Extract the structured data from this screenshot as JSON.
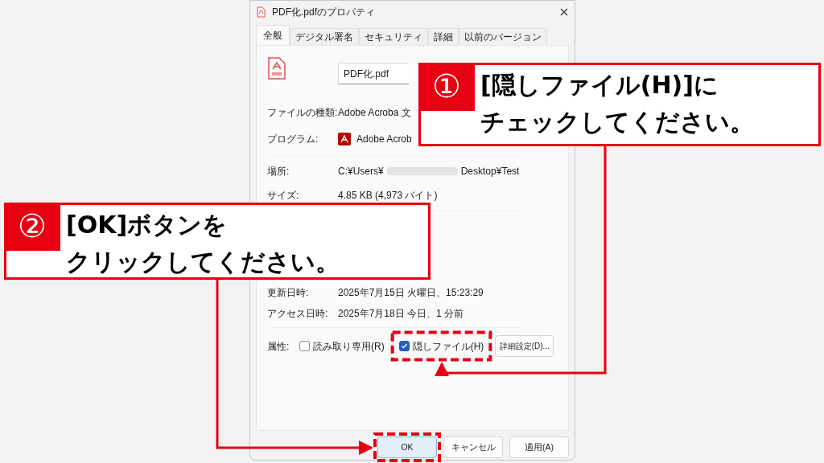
{
  "window": {
    "title": "PDF化.pdfのプロパティ"
  },
  "tabs": [
    {
      "label": "全般",
      "selected": true
    },
    {
      "label": "デジタル署名",
      "selected": false
    },
    {
      "label": "セキュリティ",
      "selected": false
    },
    {
      "label": "詳細",
      "selected": false
    },
    {
      "label": "以前のバージョン",
      "selected": false
    }
  ],
  "filename": {
    "value": "PDF化.pdf"
  },
  "sections": [
    [
      {
        "kind": "text",
        "label": "ファイルの種類:",
        "value": "Adobe Acroba 文"
      },
      {
        "kind": "program",
        "label": "プログラム:",
        "value": "Adobe Acrob"
      }
    ],
    [
      {
        "kind": "text",
        "label": "場所:",
        "value": "C:¥Users¥",
        "value_end": "Desktop¥Test"
      },
      {
        "kind": "text",
        "label": "サイズ:",
        "value": "4.85 KB (4,973 バイト)"
      }
    ],
    [
      {
        "kind": "text",
        "label": "更新日時:",
        "value": "2025年7月15日 火曜日、15:23:29"
      },
      {
        "kind": "text",
        "label": "アクセス日時:",
        "value": "2025年7月18日 今日、1 分前"
      }
    ]
  ],
  "attributes": {
    "label": "属性:",
    "checkboxes": [
      {
        "label": "読み取り専用(R)",
        "checked": false
      },
      {
        "label": "隠しファイル(H)",
        "checked": true
      }
    ],
    "advanced_button": "詳細設定(D)..."
  },
  "buttons": [
    {
      "label": "OK",
      "default": true
    },
    {
      "label": "キャンセル",
      "default": false
    },
    {
      "label": "適用(A)",
      "default": false
    }
  ],
  "callouts": [
    {
      "number": "①",
      "lines": [
        "[隠しファイル(H)]に",
        "チェックしてください。"
      ]
    },
    {
      "number": "②",
      "lines": [
        "[OK]ボタンを",
        "クリックしてください。"
      ]
    }
  ]
}
